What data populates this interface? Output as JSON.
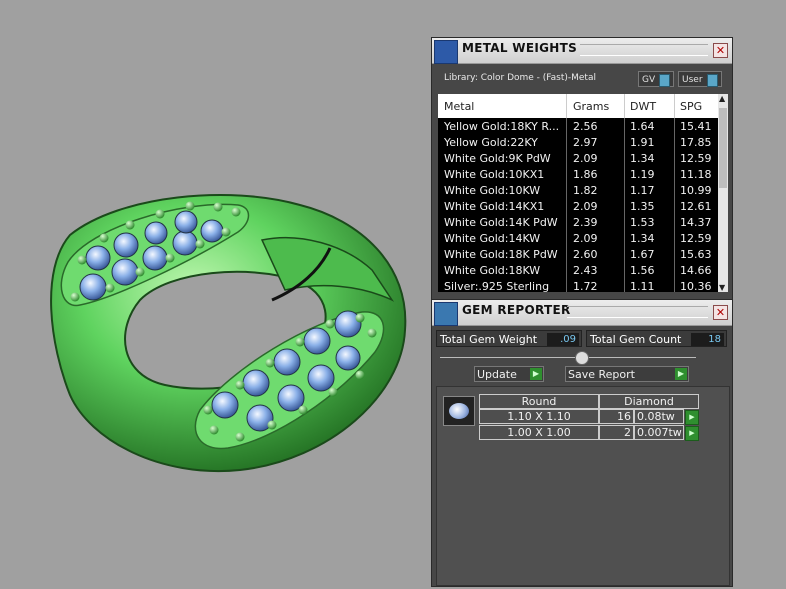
{
  "metal_weights": {
    "title": "METAL WEIGHTS",
    "close": "✕",
    "library_label": "Library: Color Dome - (Fast)-Metal",
    "toggle_gv": "GV",
    "toggle_user": "User",
    "columns": [
      "Metal",
      "Grams",
      "DWT",
      "SPG"
    ],
    "rows": [
      [
        "Yellow Gold:18KY R...",
        "2.56",
        "1.64",
        "15.41"
      ],
      [
        "Yellow Gold:22KY",
        "2.97",
        "1.91",
        "17.85"
      ],
      [
        "White Gold:9K PdW",
        "2.09",
        "1.34",
        "12.59"
      ],
      [
        "White Gold:10KX1",
        "1.86",
        "1.19",
        "11.18"
      ],
      [
        "White Gold:10KW",
        "1.82",
        "1.17",
        "10.99"
      ],
      [
        "White Gold:14KX1",
        "2.09",
        "1.35",
        "12.61"
      ],
      [
        "White Gold:14K PdW",
        "2.39",
        "1.53",
        "14.37"
      ],
      [
        "White Gold:14KW",
        "2.09",
        "1.34",
        "12.59"
      ],
      [
        "White Gold:18K PdW",
        "2.60",
        "1.67",
        "15.63"
      ],
      [
        "White Gold:18KW",
        "2.43",
        "1.56",
        "14.66"
      ],
      [
        "Silver:.925 Sterling",
        "1.72",
        "1.11",
        "10.36"
      ]
    ]
  },
  "gem_reporter": {
    "title": "GEM REPORTER",
    "close": "✕",
    "total_weight_label": "Total Gem Weight",
    "total_weight_value": ".09",
    "total_count_label": "Total Gem Count",
    "total_count_value": "18",
    "update_label": "Update",
    "save_label": "Save Report",
    "shape_header": "Round",
    "material_header": "Diamond",
    "gems": [
      {
        "size": "1.10 X 1.10",
        "count": "16",
        "weight": "0.08tw"
      },
      {
        "size": "1.00 X 1.00",
        "count": "2",
        "weight": "0.007tw"
      }
    ]
  },
  "colors": {
    "ring_green": "#5fd35f",
    "gem_blue": "#8ab0e8",
    "background": "#a0a0a0"
  }
}
